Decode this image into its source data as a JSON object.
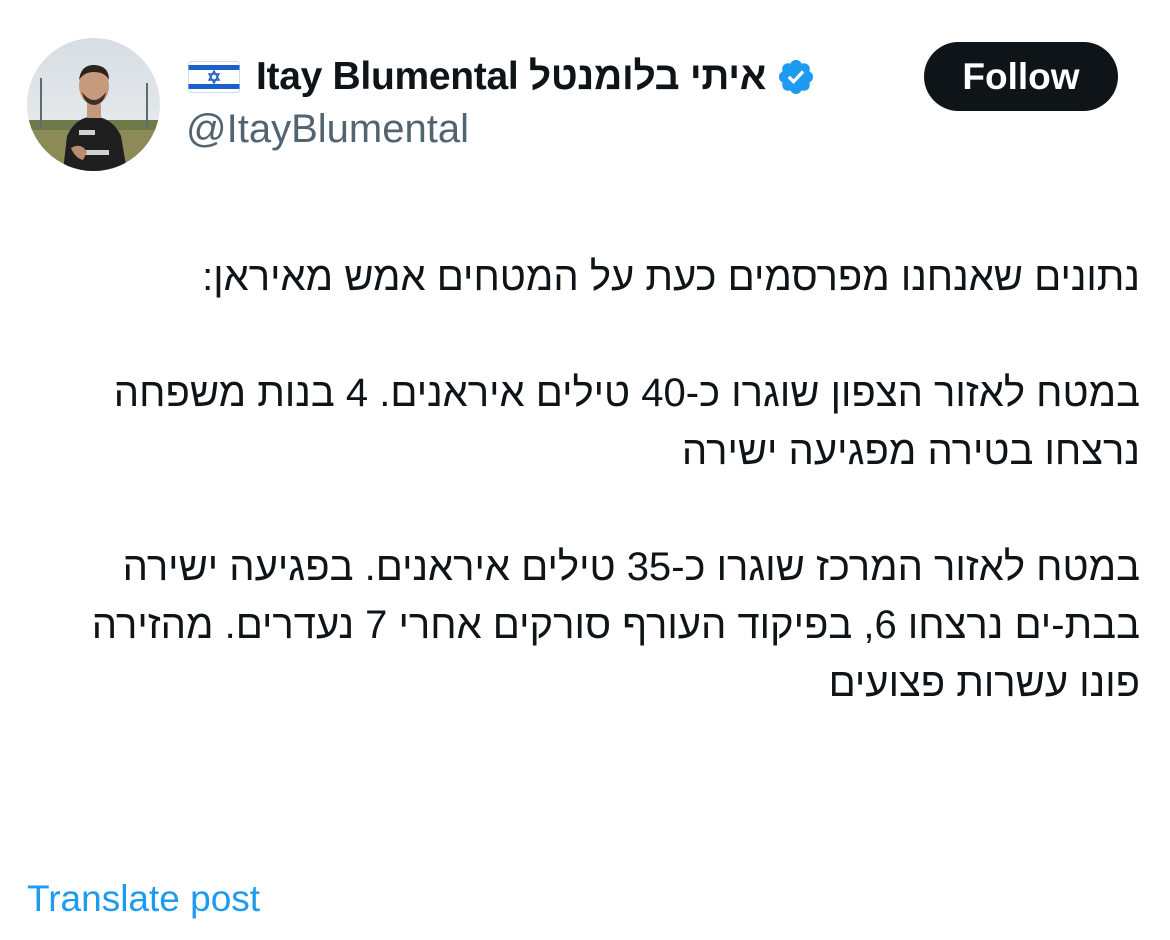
{
  "author": {
    "flag_icon": "israel-flag-icon",
    "display_name": "Itay Blumental איתי בלומנטל",
    "verified_icon": "verified-badge-icon",
    "handle": "@ItayBlumental",
    "follow_label": "Follow"
  },
  "post": {
    "paragraphs": [
      "נתונים שאנחנו מפרסמים כעת על המטחים אמש מאיראן:",
      "במטח לאזור הצפון שוגרו כ-40 טילים איראנים. 4 בנות משפחה נרצחו בטירה מפגיעה ישירה",
      "במטח לאזור המרכז שוגרו כ-35 טילים איראנים. בפגיעה ישירה בבת-ים נרצחו 6, בפיקוד העורף סורקים אחרי 7 נעדרים. מהזירה פונו עשרות פצועים"
    ],
    "translate_label": "Translate post"
  },
  "colors": {
    "text": "#0f1419",
    "secondary_text": "#536471",
    "link": "#1d9bf0",
    "verified": "#1d9bf0",
    "follow_bg": "#0f1419"
  }
}
